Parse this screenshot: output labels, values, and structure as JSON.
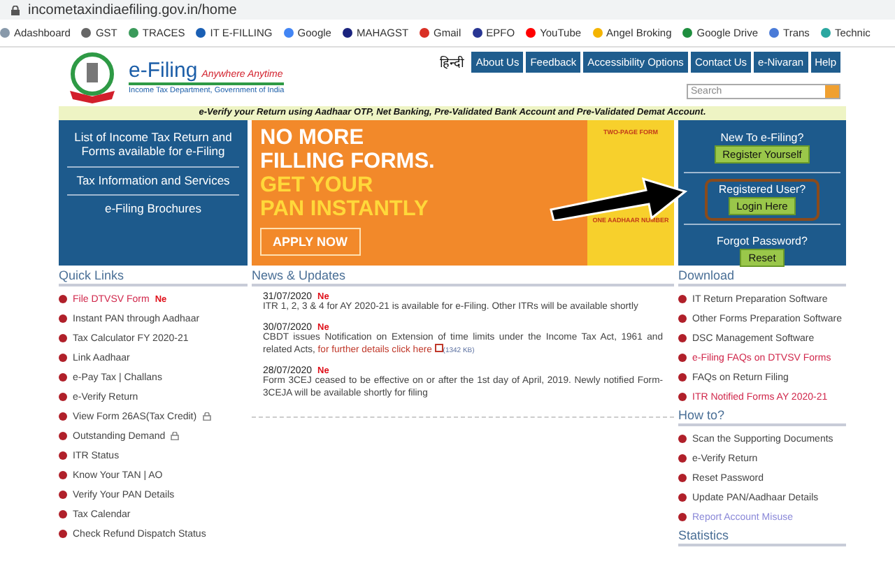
{
  "browser": {
    "url": "incometaxindiaefiling.gov.in/home",
    "bookmarks": [
      {
        "label": "Adashboard",
        "color": "#8899aa"
      },
      {
        "label": "GST",
        "color": "#666666"
      },
      {
        "label": "TRACES",
        "color": "#3a9a5a"
      },
      {
        "label": "IT E-FILLING",
        "color": "#1a5fb4"
      },
      {
        "label": "Google",
        "color": "#4285f4"
      },
      {
        "label": "MAHAGST",
        "color": "#1a237e"
      },
      {
        "label": "Gmail",
        "color": "#d93025"
      },
      {
        "label": "EPFO",
        "color": "#283593"
      },
      {
        "label": "YouTube",
        "color": "#ff0000"
      },
      {
        "label": "Angel Broking",
        "color": "#f4b400"
      },
      {
        "label": "Google Drive",
        "color": "#1e8e3e"
      },
      {
        "label": "Trans",
        "color": "#4a7bd8"
      },
      {
        "label": "Technic",
        "color": "#2aa7a0"
      }
    ]
  },
  "header": {
    "title": "e-Filing",
    "tagline": "Anywhere Anytime",
    "subtitle": "Income Tax Department, Government of India",
    "language": "हिन्दी",
    "nav": [
      "About Us",
      "Feedback",
      "Accessibility Options",
      "Contact Us",
      "e-Nivaran",
      "Help"
    ],
    "search": {
      "placeholder": "Search"
    }
  },
  "ticker": "e-Verify your Return using Aadhaar OTP, Net Banking, Pre-Validated Bank Account and Pre-Validated Demat Account.",
  "left_menu": [
    "List of Income Tax Return and Forms available for e-Filing",
    "Tax Information and Services",
    "e-Filing Brochures"
  ],
  "banner": {
    "lines": [
      {
        "text": "NO MORE",
        "kind": "white"
      },
      {
        "text": "FILLING FORMS.",
        "kind": "white"
      },
      {
        "text": "GET YOUR",
        "kind": "yellow"
      },
      {
        "text": "PAN INSTANTLY",
        "kind": "yellow"
      }
    ],
    "button": "APPLY NOW",
    "side_top": "TWO-PAGE FORM",
    "side_bottom": "ONE AADHAAR NUMBER"
  },
  "account": [
    {
      "heading": "New To e-Filing?",
      "button": "Register Yourself",
      "highlighted": false
    },
    {
      "heading": "Registered User?",
      "button": "Login Here",
      "highlighted": true
    },
    {
      "heading": "Forgot Password?",
      "button": "Reset",
      "highlighted": false
    }
  ],
  "quick_links": {
    "title": "Quick Links",
    "items": [
      {
        "label": "File DTVSV Form",
        "kind": "highlight",
        "badge": "Ne",
        "locked": false
      },
      {
        "label": "Instant PAN through Aadhaar",
        "kind": "plain",
        "locked": false
      },
      {
        "label": "Tax Calculator FY 2020-21",
        "kind": "plain",
        "locked": false
      },
      {
        "label": "Link Aadhaar",
        "kind": "plain",
        "locked": false
      },
      {
        "label": "e-Pay Tax | Challans",
        "kind": "plain",
        "locked": false
      },
      {
        "label": "e-Verify Return",
        "kind": "plain",
        "locked": false
      },
      {
        "label": "View Form 26AS(Tax Credit)",
        "kind": "plain",
        "locked": true
      },
      {
        "label": "Outstanding Demand",
        "kind": "plain",
        "locked": true
      },
      {
        "label": "ITR Status",
        "kind": "plain",
        "locked": false
      },
      {
        "label": "Know Your TAN | AO",
        "kind": "plain",
        "locked": false
      },
      {
        "label": "Verify Your PAN Details",
        "kind": "plain",
        "locked": false
      },
      {
        "label": "Tax Calendar",
        "kind": "plain",
        "locked": false
      },
      {
        "label": "Check Refund Dispatch Status",
        "kind": "plain",
        "locked": false
      }
    ]
  },
  "news": {
    "title": "News & Updates",
    "items": [
      {
        "date": "31/07/2020",
        "badge": "Ne",
        "text": "ITR 1, 2, 3 & 4 for AY 2020-21 is available for e-Filing. Other ITRs will be available shortly"
      },
      {
        "date": "30/07/2020",
        "badge": "Ne",
        "text": "CBDT issues Notification on Extension of time limits under the Income Tax Act, 1961 and related Acts, ",
        "link": "for further details click here",
        "size": "(1342 KB)"
      },
      {
        "date": "28/07/2020",
        "badge": "Ne",
        "text": "Form 3CEJ ceased to be effective on or after the 1st day of April, 2019. Newly notified Form-3CEJA will be available shortly for filing"
      }
    ]
  },
  "download": {
    "title": "Download",
    "items": [
      {
        "label": "IT Return Preparation Software",
        "kind": "plain"
      },
      {
        "label": "Other Forms Preparation Software",
        "kind": "plain"
      },
      {
        "label": "DSC Management Software",
        "kind": "plain"
      },
      {
        "label": "e-Filing FAQs on DTVSV Forms",
        "kind": "highlight"
      },
      {
        "label": "FAQs on Return Filing",
        "kind": "plain"
      },
      {
        "label": "ITR Notified Forms AY 2020-21",
        "kind": "highlight"
      }
    ]
  },
  "how_to": {
    "title": "How to?",
    "items": [
      {
        "label": "Scan the Supporting Documents",
        "kind": "plain"
      },
      {
        "label": "e-Verify Return",
        "kind": "plain"
      },
      {
        "label": "Reset Password",
        "kind": "plain"
      },
      {
        "label": "Update PAN/Aadhaar Details",
        "kind": "plain"
      },
      {
        "label": "Report Account Misuse",
        "kind": "visited"
      }
    ]
  },
  "statistics": {
    "title": "Statistics"
  }
}
